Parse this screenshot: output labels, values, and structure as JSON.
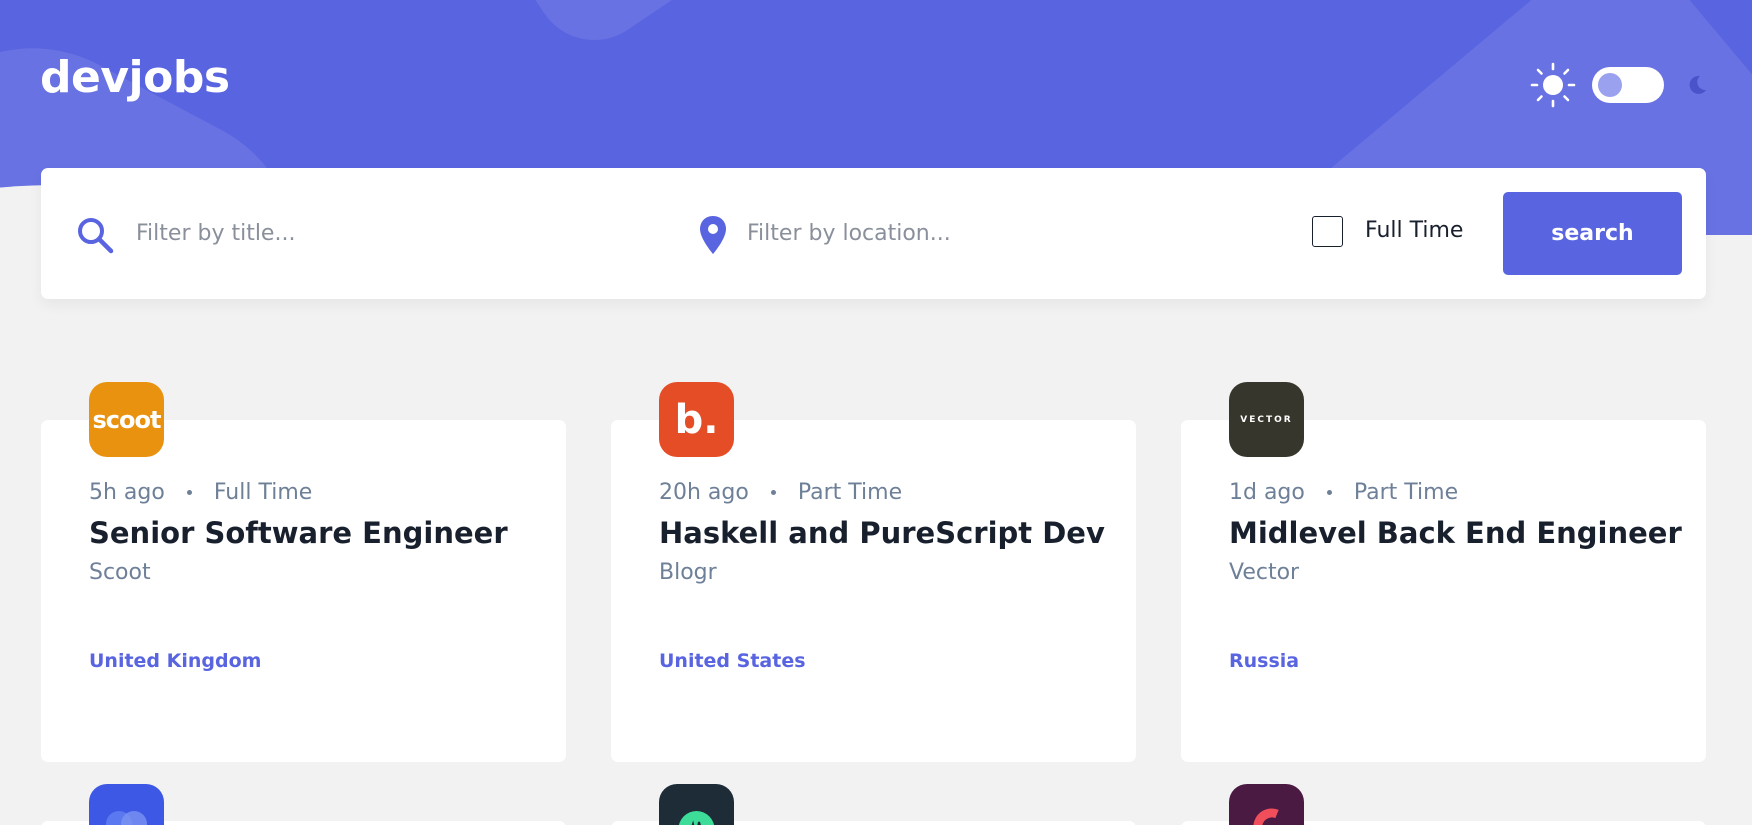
{
  "header": {
    "logo": "devjobs",
    "theme": {
      "sun_icon": "sun-icon",
      "moon_icon": "moon-icon",
      "dark_mode": false
    }
  },
  "search": {
    "title_placeholder": "Filter by title...",
    "title_value": "",
    "location_placeholder": "Filter by location...",
    "location_value": "",
    "fulltime_label": "Full Time",
    "fulltime_checked": false,
    "button_label": "search"
  },
  "colors": {
    "accent": "#5964e0",
    "background": "#f2f2f2",
    "text_dark": "#19202d",
    "text_gray": "#6e8098"
  },
  "jobs": [
    {
      "posted": "5h ago",
      "contract": "Full Time",
      "position": "Senior Software Engineer",
      "company": "Scoot",
      "location": "United Kingdom",
      "logo_text": "scoot",
      "logo_color": "#e99210"
    },
    {
      "posted": "20h ago",
      "contract": "Part Time",
      "position": "Haskell and PureScript Dev",
      "company": "Blogr",
      "location": "United States",
      "logo_text": "b.",
      "logo_color": "#e54d26"
    },
    {
      "posted": "1d ago",
      "contract": "Part Time",
      "position": "Midlevel Back End Engineer",
      "company": "Vector",
      "location": "Russia",
      "logo_text": "VECTOR",
      "logo_color": "#36362c"
    }
  ],
  "partial_jobs": [
    {
      "logo_color": "#3c58e4"
    },
    {
      "logo_color": "#1d2c37"
    },
    {
      "logo_color": "#4b1a43"
    }
  ]
}
